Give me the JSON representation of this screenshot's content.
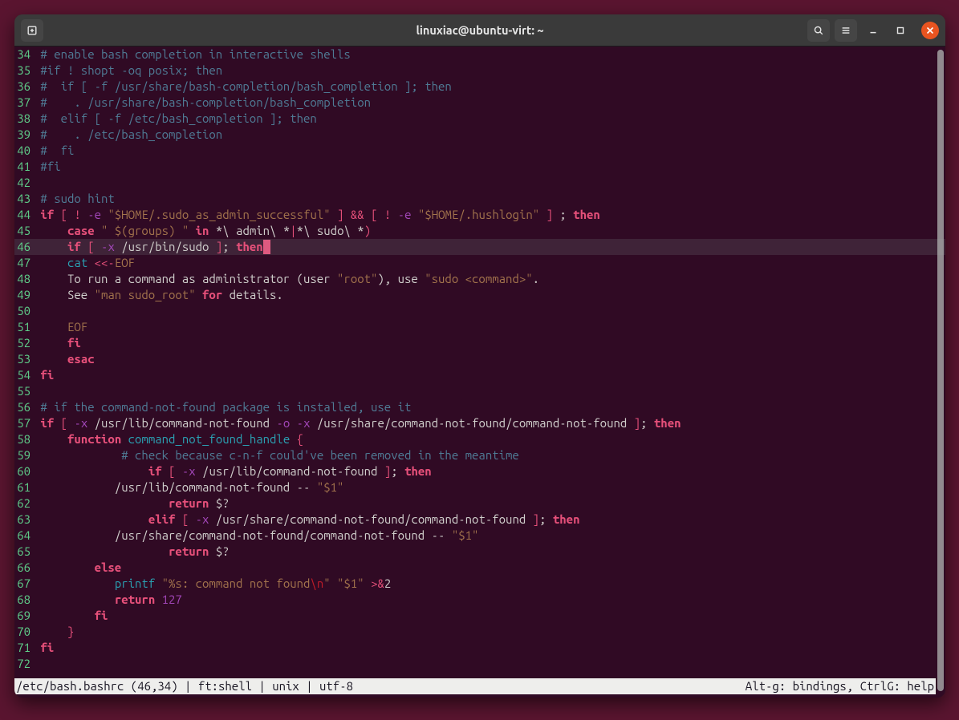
{
  "window": {
    "title": "linuxiac@ubuntu-virt: ~"
  },
  "editor": {
    "cursor_line": 46,
    "lines": [
      {
        "n": 34,
        "spans": [
          {
            "cls": "c-comment",
            "t": "# enable bash completion in interactive shells"
          }
        ]
      },
      {
        "n": 35,
        "spans": [
          {
            "cls": "c-comment",
            "t": "#if ! shopt -oq posix; then"
          }
        ]
      },
      {
        "n": 36,
        "spans": [
          {
            "cls": "c-comment",
            "t": "#  if [ -f /usr/share/bash-completion/bash_completion ]; then"
          }
        ]
      },
      {
        "n": 37,
        "spans": [
          {
            "cls": "c-comment",
            "t": "#    . /usr/share/bash-completion/bash_completion"
          }
        ]
      },
      {
        "n": 38,
        "spans": [
          {
            "cls": "c-comment",
            "t": "#  elif [ -f /etc/bash_completion ]; then"
          }
        ]
      },
      {
        "n": 39,
        "spans": [
          {
            "cls": "c-comment",
            "t": "#    . /etc/bash_completion"
          }
        ]
      },
      {
        "n": 40,
        "spans": [
          {
            "cls": "c-comment",
            "t": "#  fi"
          }
        ]
      },
      {
        "n": 41,
        "spans": [
          {
            "cls": "c-comment",
            "t": "#fi"
          }
        ]
      },
      {
        "n": 42,
        "spans": [
          {
            "cls": "",
            "t": ""
          }
        ]
      },
      {
        "n": 43,
        "spans": [
          {
            "cls": "c-comment",
            "t": "# sudo hint"
          }
        ]
      },
      {
        "n": 44,
        "spans": [
          {
            "cls": "c-kw",
            "t": "if"
          },
          {
            "cls": "",
            "t": " "
          },
          {
            "cls": "c-op",
            "t": "["
          },
          {
            "cls": "",
            "t": " "
          },
          {
            "cls": "c-op",
            "t": "!"
          },
          {
            "cls": "",
            "t": " "
          },
          {
            "cls": "c-option",
            "t": "-e"
          },
          {
            "cls": "",
            "t": " "
          },
          {
            "cls": "c-str",
            "t": "\"$HOME/.sudo_as_admin_successful\""
          },
          {
            "cls": "",
            "t": " "
          },
          {
            "cls": "c-op",
            "t": "]"
          },
          {
            "cls": "",
            "t": " "
          },
          {
            "cls": "c-op",
            "t": "&&"
          },
          {
            "cls": "",
            "t": " "
          },
          {
            "cls": "c-op",
            "t": "["
          },
          {
            "cls": "",
            "t": " "
          },
          {
            "cls": "c-op",
            "t": "!"
          },
          {
            "cls": "",
            "t": " "
          },
          {
            "cls": "c-option",
            "t": "-e"
          },
          {
            "cls": "",
            "t": " "
          },
          {
            "cls": "c-str",
            "t": "\"$HOME/.hushlogin\""
          },
          {
            "cls": "",
            "t": " "
          },
          {
            "cls": "c-op",
            "t": "]"
          },
          {
            "cls": "",
            "t": " ; "
          },
          {
            "cls": "c-kw",
            "t": "then"
          }
        ]
      },
      {
        "n": 45,
        "spans": [
          {
            "cls": "",
            "t": "    "
          },
          {
            "cls": "c-kw",
            "t": "case"
          },
          {
            "cls": "",
            "t": " "
          },
          {
            "cls": "c-str",
            "t": "\" $(groups) \""
          },
          {
            "cls": "",
            "t": " "
          },
          {
            "cls": "c-kw",
            "t": "in"
          },
          {
            "cls": "",
            "t": " *\\ admin\\ *"
          },
          {
            "cls": "c-op",
            "t": "|"
          },
          {
            "cls": "",
            "t": "*\\ sudo\\ *"
          },
          {
            "cls": "c-op",
            "t": ")"
          }
        ]
      },
      {
        "n": 46,
        "hl": true,
        "cursor_after": true,
        "spans": [
          {
            "cls": "",
            "t": "    "
          },
          {
            "cls": "c-kw",
            "t": "if"
          },
          {
            "cls": "",
            "t": " "
          },
          {
            "cls": "c-op",
            "t": "["
          },
          {
            "cls": "",
            "t": " "
          },
          {
            "cls": "c-option",
            "t": "-x"
          },
          {
            "cls": "",
            "t": " /usr/bin/sudo "
          },
          {
            "cls": "c-op",
            "t": "]"
          },
          {
            "cls": "",
            "t": "; "
          },
          {
            "cls": "c-kw",
            "t": "then"
          }
        ]
      },
      {
        "n": 47,
        "spans": [
          {
            "cls": "",
            "t": "    "
          },
          {
            "cls": "c-cyan",
            "t": "cat"
          },
          {
            "cls": "",
            "t": " "
          },
          {
            "cls": "c-op",
            "t": "<<-"
          },
          {
            "cls": "c-str",
            "t": "EOF"
          }
        ]
      },
      {
        "n": 48,
        "spans": [
          {
            "cls": "",
            "t": "    To run a command as administrator (user "
          },
          {
            "cls": "c-str",
            "t": "\"root\""
          },
          {
            "cls": "",
            "t": "), use "
          },
          {
            "cls": "c-str",
            "t": "\"sudo <command>\""
          },
          {
            "cls": "",
            "t": "."
          }
        ]
      },
      {
        "n": 49,
        "spans": [
          {
            "cls": "",
            "t": "    See "
          },
          {
            "cls": "c-str",
            "t": "\"man sudo_root\""
          },
          {
            "cls": "",
            "t": " "
          },
          {
            "cls": "c-kw",
            "t": "for"
          },
          {
            "cls": "",
            "t": " details."
          }
        ]
      },
      {
        "n": 50,
        "spans": [
          {
            "cls": "",
            "t": ""
          }
        ]
      },
      {
        "n": 51,
        "spans": [
          {
            "cls": "",
            "t": "    "
          },
          {
            "cls": "c-str",
            "t": "EOF"
          }
        ]
      },
      {
        "n": 52,
        "spans": [
          {
            "cls": "",
            "t": "    "
          },
          {
            "cls": "c-kw",
            "t": "fi"
          }
        ]
      },
      {
        "n": 53,
        "spans": [
          {
            "cls": "",
            "t": "    "
          },
          {
            "cls": "c-kw",
            "t": "esac"
          }
        ]
      },
      {
        "n": 54,
        "spans": [
          {
            "cls": "c-kw",
            "t": "fi"
          }
        ]
      },
      {
        "n": 55,
        "spans": [
          {
            "cls": "",
            "t": ""
          }
        ]
      },
      {
        "n": 56,
        "spans": [
          {
            "cls": "c-comment",
            "t": "# if the command-not-found package is installed, use it"
          }
        ]
      },
      {
        "n": 57,
        "spans": [
          {
            "cls": "c-kw",
            "t": "if"
          },
          {
            "cls": "",
            "t": " "
          },
          {
            "cls": "c-op",
            "t": "["
          },
          {
            "cls": "",
            "t": " "
          },
          {
            "cls": "c-option",
            "t": "-x"
          },
          {
            "cls": "",
            "t": " /usr/lib/command-not-found "
          },
          {
            "cls": "c-option",
            "t": "-o"
          },
          {
            "cls": "",
            "t": " "
          },
          {
            "cls": "c-option",
            "t": "-x"
          },
          {
            "cls": "",
            "t": " /usr/share/command-not-found/command-not-found "
          },
          {
            "cls": "c-op",
            "t": "]"
          },
          {
            "cls": "",
            "t": "; "
          },
          {
            "cls": "c-kw",
            "t": "then"
          }
        ]
      },
      {
        "n": 58,
        "spans": [
          {
            "cls": "",
            "t": "    "
          },
          {
            "cls": "c-kw",
            "t": "function"
          },
          {
            "cls": "",
            "t": " "
          },
          {
            "cls": "c-cyan",
            "t": "command_not_found_handle"
          },
          {
            "cls": "",
            "t": " "
          },
          {
            "cls": "c-op",
            "t": "{"
          }
        ]
      },
      {
        "n": 59,
        "spans": [
          {
            "cls": "",
            "t": "            "
          },
          {
            "cls": "c-comment",
            "t": "# check because c-n-f could've been removed in the meantime"
          }
        ]
      },
      {
        "n": 60,
        "spans": [
          {
            "cls": "",
            "t": "                "
          },
          {
            "cls": "c-kw",
            "t": "if"
          },
          {
            "cls": "",
            "t": " "
          },
          {
            "cls": "c-op",
            "t": "["
          },
          {
            "cls": "",
            "t": " "
          },
          {
            "cls": "c-option",
            "t": "-x"
          },
          {
            "cls": "",
            "t": " /usr/lib/command-not-found "
          },
          {
            "cls": "c-op",
            "t": "]"
          },
          {
            "cls": "",
            "t": "; "
          },
          {
            "cls": "c-kw",
            "t": "then"
          }
        ]
      },
      {
        "n": 61,
        "spans": [
          {
            "cls": "",
            "t": "           /usr/lib/command-not-found -- "
          },
          {
            "cls": "c-str",
            "t": "\"$1\""
          }
        ]
      },
      {
        "n": 62,
        "spans": [
          {
            "cls": "",
            "t": "                   "
          },
          {
            "cls": "c-kw",
            "t": "return"
          },
          {
            "cls": "",
            "t": " $?"
          }
        ]
      },
      {
        "n": 63,
        "spans": [
          {
            "cls": "",
            "t": "                "
          },
          {
            "cls": "c-kw",
            "t": "elif"
          },
          {
            "cls": "",
            "t": " "
          },
          {
            "cls": "c-op",
            "t": "["
          },
          {
            "cls": "",
            "t": " "
          },
          {
            "cls": "c-option",
            "t": "-x"
          },
          {
            "cls": "",
            "t": " /usr/share/command-not-found/command-not-found "
          },
          {
            "cls": "c-op",
            "t": "]"
          },
          {
            "cls": "",
            "t": "; "
          },
          {
            "cls": "c-kw",
            "t": "then"
          }
        ]
      },
      {
        "n": 64,
        "spans": [
          {
            "cls": "",
            "t": "           /usr/share/command-not-found/command-not-found -- "
          },
          {
            "cls": "c-str",
            "t": "\"$1\""
          }
        ]
      },
      {
        "n": 65,
        "spans": [
          {
            "cls": "",
            "t": "                   "
          },
          {
            "cls": "c-kw",
            "t": "return"
          },
          {
            "cls": "",
            "t": " $?"
          }
        ]
      },
      {
        "n": 66,
        "spans": [
          {
            "cls": "",
            "t": "        "
          },
          {
            "cls": "c-kw",
            "t": "else"
          }
        ]
      },
      {
        "n": 67,
        "spans": [
          {
            "cls": "",
            "t": "           "
          },
          {
            "cls": "c-cyan",
            "t": "printf"
          },
          {
            "cls": "",
            "t": " "
          },
          {
            "cls": "c-str",
            "t": "\"%s: command not found"
          },
          {
            "cls": "c-red",
            "t": "\\n"
          },
          {
            "cls": "c-str",
            "t": "\""
          },
          {
            "cls": "",
            "t": " "
          },
          {
            "cls": "c-str",
            "t": "\"$1\""
          },
          {
            "cls": "",
            "t": " "
          },
          {
            "cls": "c-op",
            "t": ">&"
          },
          {
            "cls": "",
            "t": "2"
          }
        ]
      },
      {
        "n": 68,
        "spans": [
          {
            "cls": "",
            "t": "           "
          },
          {
            "cls": "c-kw",
            "t": "return"
          },
          {
            "cls": "",
            "t": " "
          },
          {
            "cls": "c-num",
            "t": "127"
          }
        ]
      },
      {
        "n": 69,
        "spans": [
          {
            "cls": "",
            "t": "        "
          },
          {
            "cls": "c-kw",
            "t": "fi"
          }
        ]
      },
      {
        "n": 70,
        "spans": [
          {
            "cls": "",
            "t": "    "
          },
          {
            "cls": "c-op",
            "t": "}"
          }
        ]
      },
      {
        "n": 71,
        "spans": [
          {
            "cls": "c-kw",
            "t": "fi"
          }
        ]
      },
      {
        "n": 72,
        "spans": [
          {
            "cls": "",
            "t": ""
          }
        ]
      }
    ]
  },
  "statusbar": {
    "left": "/etc/bash.bashrc (46,34) | ft:shell | unix | utf-8 ",
    "right": "Alt-g: bindings, CtrlG: help"
  }
}
